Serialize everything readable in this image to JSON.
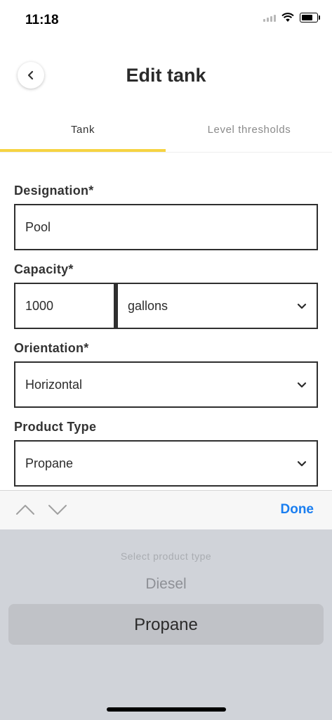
{
  "status_bar": {
    "time": "11:18"
  },
  "header": {
    "title": "Edit tank"
  },
  "tabs": [
    {
      "label": "Tank",
      "active": true
    },
    {
      "label": "Level thresholds",
      "active": false
    }
  ],
  "colors": {
    "accent": "#f6d342",
    "done": "#1a7ef0",
    "border": "#2f2f2f"
  },
  "form": {
    "designation": {
      "label": "Designation*",
      "value": "Pool"
    },
    "capacity": {
      "label": "Capacity*",
      "value": "1000",
      "unit": "gallons"
    },
    "orientation": {
      "label": "Orientation*",
      "value": "Horizontal"
    },
    "product_type": {
      "label": "Product Type",
      "value": "Propane"
    }
  },
  "keyboard_accessory": {
    "done_label": "Done"
  },
  "picker": {
    "placeholder": "Select product type",
    "options": [
      "Diesel",
      "Propane"
    ],
    "selected": "Propane"
  }
}
